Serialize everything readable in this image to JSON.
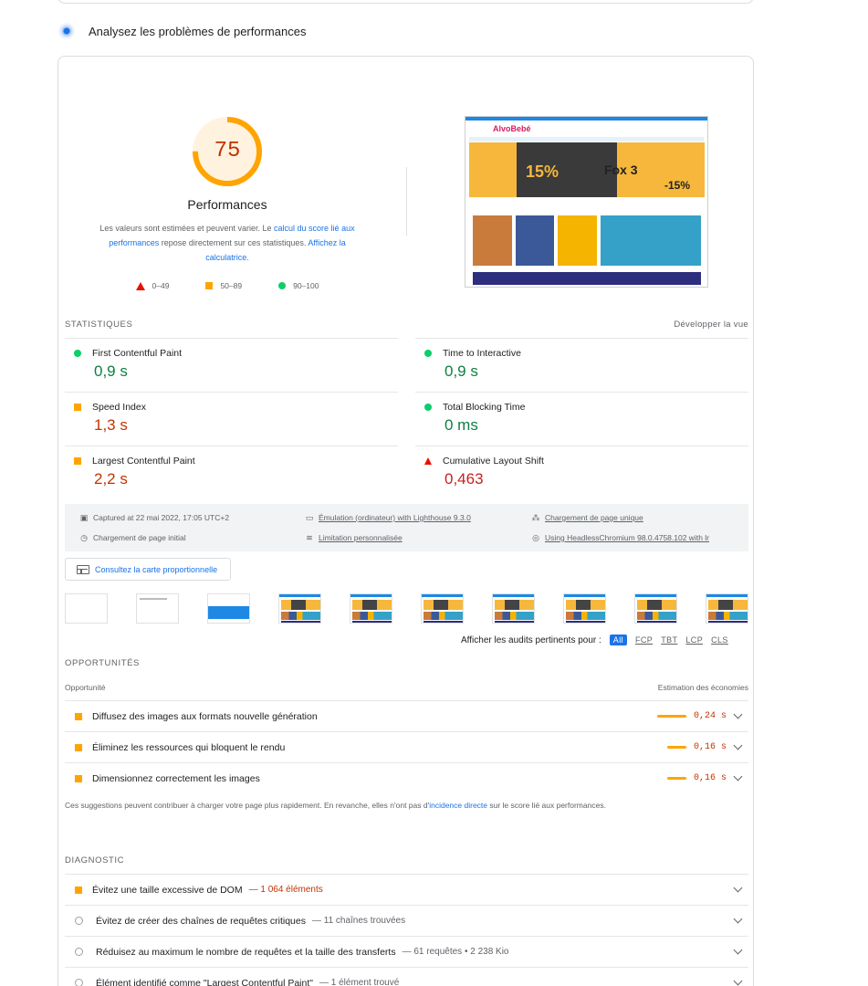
{
  "section": {
    "title": "Analysez les problèmes de performances"
  },
  "gauge": {
    "score": "75",
    "score_fraction": 0.75,
    "label": "Performances",
    "desc_prefix": "Les valeurs sont estimées et peuvent varier. Le ",
    "desc_link1": "calcul du score lié aux performances",
    "desc_middle": " repose directement sur ces statistiques. ",
    "desc_link2": "Affichez la calculatrice.",
    "legend": [
      "0–49",
      "50–89",
      "90–100"
    ]
  },
  "screenshot": {
    "logo": "AlvoBebé",
    "pct": "15%",
    "model": "Fox 3",
    "discount": "-15%"
  },
  "stats": {
    "header": "STATISTIQUES",
    "expand": "Développer la vue",
    "metrics": [
      {
        "label": "First Contentful Paint",
        "value": "0,9 s",
        "rating": "good"
      },
      {
        "label": "Time to Interactive",
        "value": "0,9 s",
        "rating": "good"
      },
      {
        "label": "Speed Index",
        "value": "1,3 s",
        "rating": "average"
      },
      {
        "label": "Total Blocking Time",
        "value": "0 ms",
        "rating": "good"
      },
      {
        "label": "Largest Contentful Paint",
        "value": "2,2 s",
        "rating": "average"
      },
      {
        "label": "Cumulative Layout Shift",
        "value": "0,463",
        "rating": "poor"
      }
    ]
  },
  "environment": {
    "captured": "Captured at 22 mai 2022, 17:05 UTC+2",
    "emulation": "Émulation (ordinateur) with Lighthouse 9.3.0",
    "page_load": "Chargement de page unique",
    "initial_load": "Chargement de page initial",
    "throttling": "Limitation personnalisée",
    "browser": "Using HeadlessChromium 98.0.4758.102 with lr"
  },
  "treemap": {
    "label": "Consultez la carte proportionnelle"
  },
  "filter": {
    "label": "Afficher les audits pertinents pour :",
    "chips": [
      "All",
      "FCP",
      "TBT",
      "LCP",
      "CLS"
    ]
  },
  "opportunities": {
    "header": "OPPORTUNITÉS",
    "col_left": "Opportunité",
    "col_right": "Estimation des économies",
    "items": [
      {
        "label": "Diffusez des images aux formats nouvelle génération",
        "saving": "0,24 s",
        "saving_s": 0.24
      },
      {
        "label": "Éliminez les ressources qui bloquent le rendu",
        "saving": "0,16 s",
        "saving_s": 0.16
      },
      {
        "label": "Dimensionnez correctement les images",
        "saving": "0,16 s",
        "saving_s": 0.16
      }
    ],
    "note_prefix": "Ces suggestions peuvent contribuer à charger votre page plus rapidement. En revanche, elles n'ont pas d'",
    "note_link": "incidence directe",
    "note_suffix": " sur le score lié aux performances."
  },
  "diagnostic": {
    "header": "DIAGNOSTIC",
    "items": [
      {
        "label": "Évitez une taille excessive de DOM",
        "detail": "— 1 064 éléments",
        "rating": "average"
      },
      {
        "label": "Évitez de créer des chaînes de requêtes critiques",
        "detail": "— 11 chaînes trouvées",
        "rating": "info"
      },
      {
        "label": "Réduisez au maximum le nombre de requêtes et la taille des transferts",
        "detail": "— 61 requêtes • 2 238 Kio",
        "rating": "info"
      },
      {
        "label": "Élément identifié comme \"Largest Contentful Paint\"",
        "detail": "— 1 élément trouvé",
        "rating": "info"
      }
    ]
  },
  "colors": {
    "good": "#0cce6b",
    "average": "#ffa400",
    "poor": "#eb0f00",
    "link": "#1a73e8"
  }
}
